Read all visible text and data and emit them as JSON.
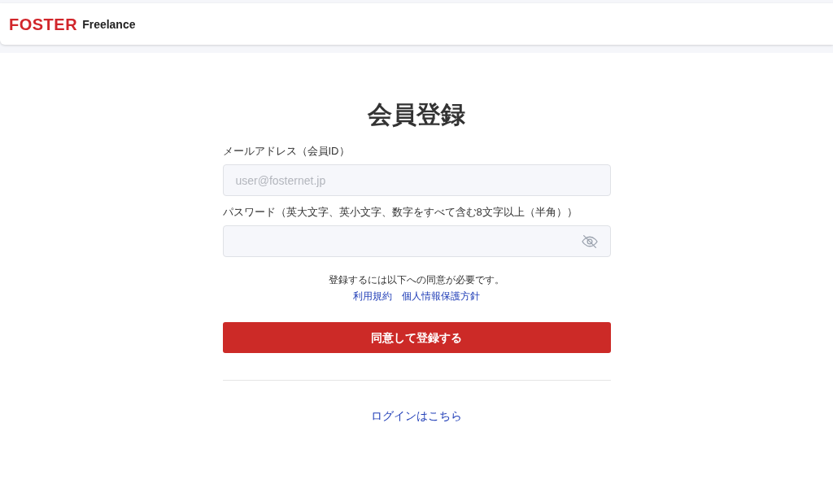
{
  "header": {
    "logo_main": "FOSTER",
    "logo_sub": "Freelance"
  },
  "title": "会員登録",
  "fields": [
    {
      "label": "メールアドレス（会員ID）",
      "placeholder": "user@fosternet.jp",
      "kind": "text"
    },
    {
      "label": "パスワード（英大文字、英小文字、数字をすべて含む8文字以上（半角））",
      "kind": "password"
    }
  ],
  "consent": {
    "text": "登録するには以下への同意が必要です。",
    "links": [
      "利用規約",
      "個人情報保護方針"
    ]
  },
  "submit": "同意して登録する",
  "login_link": "ログインはこちら"
}
